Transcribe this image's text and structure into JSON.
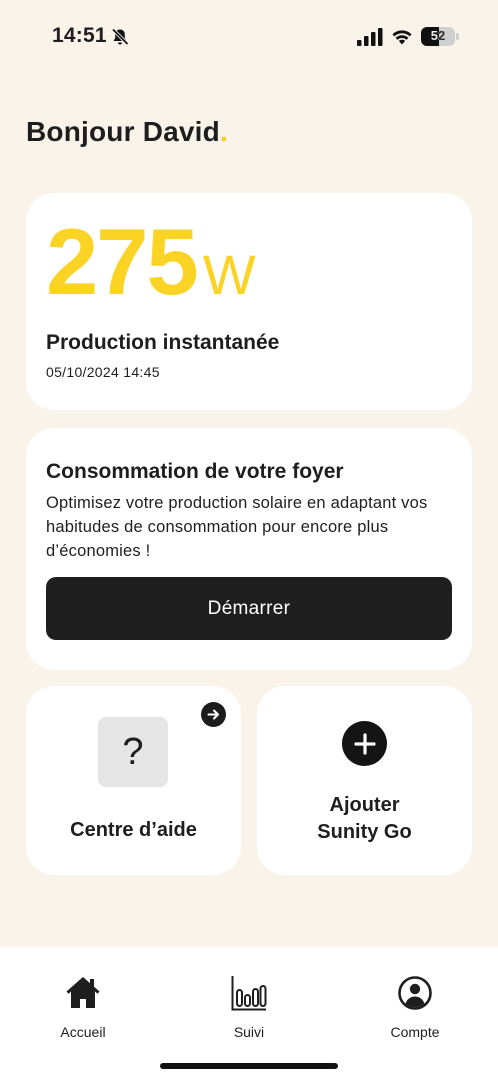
{
  "status_bar": {
    "time": "14:51",
    "battery": "52"
  },
  "greeting": {
    "text": "Bonjour David",
    "dot": "."
  },
  "production": {
    "value": "275",
    "unit": "W",
    "title": "Production instantanée",
    "datetime": "05/10/2024 14:45"
  },
  "consumption": {
    "title": "Consommation de votre foyer",
    "description": "Optimisez votre production solaire en adaptant vos habitudes de consommation pour encore plus d’économies !",
    "button_label": "Démarrer"
  },
  "help_card": {
    "icon_text": "?",
    "label": "Centre d’aide"
  },
  "add_card": {
    "label_line1": "Ajouter",
    "label_line2": "Sunity Go"
  },
  "bottom_nav": {
    "items": [
      {
        "label": "Accueil",
        "icon": "home-icon"
      },
      {
        "label": "Suivi",
        "icon": "bar-chart-icon"
      },
      {
        "label": "Compte",
        "icon": "account-icon"
      }
    ]
  },
  "colors": {
    "background": "#faf3ea",
    "accent_yellow": "#fbd324",
    "dark": "#1f1f1f"
  }
}
